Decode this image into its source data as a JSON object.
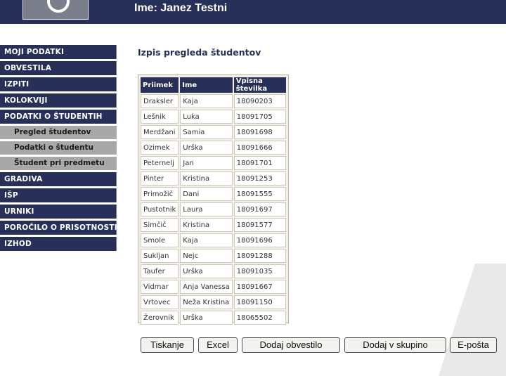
{
  "header": {
    "user_title": "Ime: Janez Testni"
  },
  "sidebar": {
    "items": [
      {
        "label": "MOJI PODATKI"
      },
      {
        "label": "OBVESTILA"
      },
      {
        "label": "IZPITI"
      },
      {
        "label": "KOLOKVIJI"
      },
      {
        "label": "PODATKI O ŠTUDENTIH"
      }
    ],
    "subitems": [
      {
        "label": "Pregled študentov"
      },
      {
        "label": "Podatki o študentu"
      },
      {
        "label": "Študent pri predmetu"
      }
    ],
    "items_after": [
      {
        "label": "GRADIVA"
      },
      {
        "label": "IŠP"
      },
      {
        "label": "URNIKI"
      },
      {
        "label": "POROČILO O PRISOTNOSTI"
      },
      {
        "label": "IZHOD"
      }
    ]
  },
  "main": {
    "title": "Izpis pregleda študentov",
    "table": {
      "headers": [
        "Priimek",
        "Ime",
        "Vpisna številka"
      ],
      "rows": [
        [
          "Draksler",
          "Kaja",
          "18090203"
        ],
        [
          "Lešnik",
          "Luka",
          "18091705"
        ],
        [
          "Merdžani",
          "Samia",
          "18091698"
        ],
        [
          "Ozimek",
          "Urška",
          "18091666"
        ],
        [
          "Peternelj",
          "Jan",
          "18091701"
        ],
        [
          "Pinter",
          "Kristina",
          "18091253"
        ],
        [
          "Primožič",
          "Dani",
          "18091555"
        ],
        [
          "Pustotnik",
          "Laura",
          "18091697"
        ],
        [
          "Simčič",
          "Kristina",
          "18091577"
        ],
        [
          "Smole",
          "Kaja",
          "18091696"
        ],
        [
          "Sukljan",
          "Nejc",
          "18091288"
        ],
        [
          "Taufer",
          "Urška",
          "18091035"
        ],
        [
          "Vidmar",
          "Anja Vanessa",
          "18091667"
        ],
        [
          "Vrtovec",
          "Neža Kristina",
          "18091150"
        ],
        [
          "Žerovnik",
          "Urška",
          "18065502"
        ]
      ]
    },
    "buttons": {
      "print": "Tiskanje",
      "excel": "Excel",
      "add_notice": "Dodaj obvestilo",
      "add_group": "Dodaj v skupino",
      "email": "E-pošta"
    }
  },
  "colors": {
    "navy": "#263058",
    "submenu": "#a8a8a8"
  }
}
